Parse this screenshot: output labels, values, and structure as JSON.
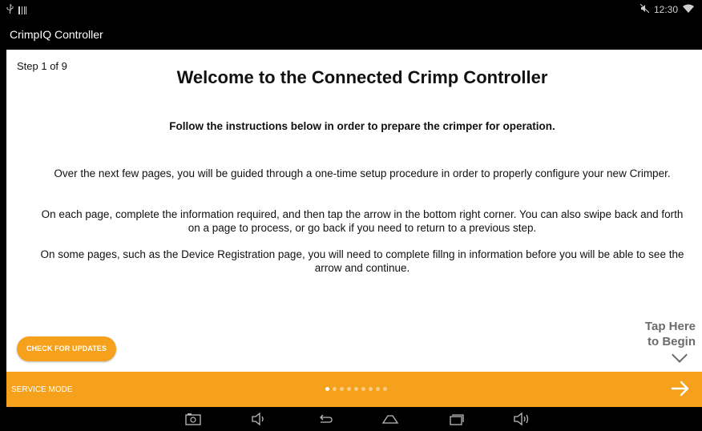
{
  "status": {
    "time": "12:30",
    "usb_icon": "usb-icon",
    "signal_icon": "signal-bars-icon",
    "mute_icon": "mute-icon",
    "wifi_icon": "wifi-icon"
  },
  "app": {
    "title": "CrimpIQ Controller"
  },
  "page": {
    "step": "Step 1 of 9",
    "title": "Welcome to the Connected Crimp Controller",
    "subtitle": "Follow the instructions below in order to prepare the crimper for operation.",
    "paragraphs": [
      "Over the next few pages, you will be guided through a one-time setup procedure in order to properly configure your new Crimper.",
      "On each page, complete the information required, and then tap the arrow in the bottom right corner. You can also swipe back and forth on a page to process, or go back if you need to return to a previous step.",
      "On some pages, such as the Device Registration page, you will need to complete fillng in information before you will be able to see the arrow and continue."
    ],
    "update_button": "CHECK FOR UPDATES",
    "tap_hint_line1": "Tap Here",
    "tap_hint_line2": "to Begin"
  },
  "footer": {
    "service_mode": "SERVICE MODE",
    "total_pages": 9,
    "current_page": 1
  },
  "colors": {
    "accent": "#f6a11b",
    "background": "#ffffff",
    "bars": "#000000"
  },
  "nav_icons": [
    "camera-icon",
    "volume-down-icon",
    "back-icon",
    "home-icon",
    "recent-apps-icon",
    "volume-up-icon"
  ]
}
